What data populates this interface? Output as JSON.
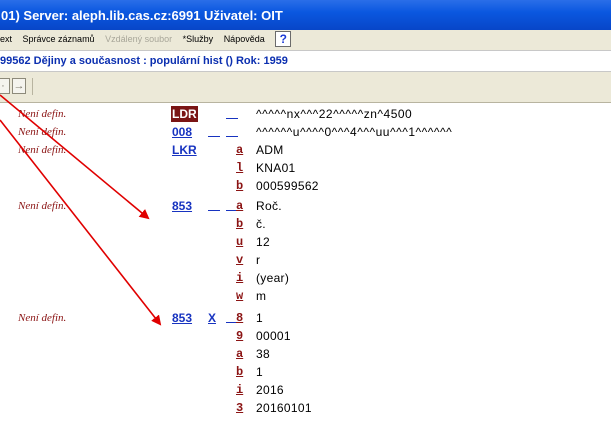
{
  "window": {
    "title": "01) Server: aleph.lib.cas.cz:6991  Uživatel: OIT"
  },
  "menu": {
    "items": [
      {
        "label": "ext",
        "disabled": false
      },
      {
        "label": "Správce záznamů",
        "disabled": false
      },
      {
        "label": "Vzdálený soubor",
        "disabled": true
      },
      {
        "label": "*Služby",
        "disabled": false
      },
      {
        "label": "Nápověda",
        "disabled": false
      }
    ],
    "help_glyph": "?"
  },
  "record_info": {
    "text": "99562 Dějiny a současnost : populární hist () Rok: 1959"
  },
  "nav": {
    "prev_glyph": "·",
    "next_glyph": "→"
  },
  "fields": [
    {
      "label": "Není defin.",
      "tag": "LDR",
      "ind1": "",
      "ind2": "",
      "code": "",
      "value": "^^^^^nx^^^22^^^^^zn^4500"
    },
    {
      "label": "Není defin.",
      "tag": "008",
      "ind1": "",
      "ind2": "",
      "code": "",
      "value": "^^^^^^u^^^^0^^^4^^^uu^^^1^^^^^^"
    },
    {
      "label": "Není defin.",
      "tag": "LKR",
      "code": "a",
      "value": "ADM"
    },
    {
      "code": "l",
      "value": "KNA01"
    },
    {
      "code": "b",
      "value": "000599562"
    },
    {
      "label": "Není defin.",
      "tag": "853",
      "ind1": "",
      "ind2": "",
      "code": "a",
      "value": "Roč."
    },
    {
      "code": "b",
      "value": "č."
    },
    {
      "code": "u",
      "value": "12"
    },
    {
      "code": "v",
      "value": "r"
    },
    {
      "code": "i",
      "value": "(year)"
    },
    {
      "code": "w",
      "value": "m"
    },
    {
      "label": "Není defin.",
      "tag": "853",
      "ind1": "X",
      "ind2": "",
      "code": "8",
      "value": "1"
    },
    {
      "code": "9",
      "value": "00001"
    },
    {
      "code": "a",
      "value": "38"
    },
    {
      "code": "b",
      "value": "1"
    },
    {
      "code": "i",
      "value": "2016"
    },
    {
      "code": "3",
      "value": "20160101"
    }
  ],
  "colors": {
    "titlebar": "#0b58e0",
    "tag": "#1733c0",
    "label": "#8b1414",
    "arrow": "#e00000"
  }
}
